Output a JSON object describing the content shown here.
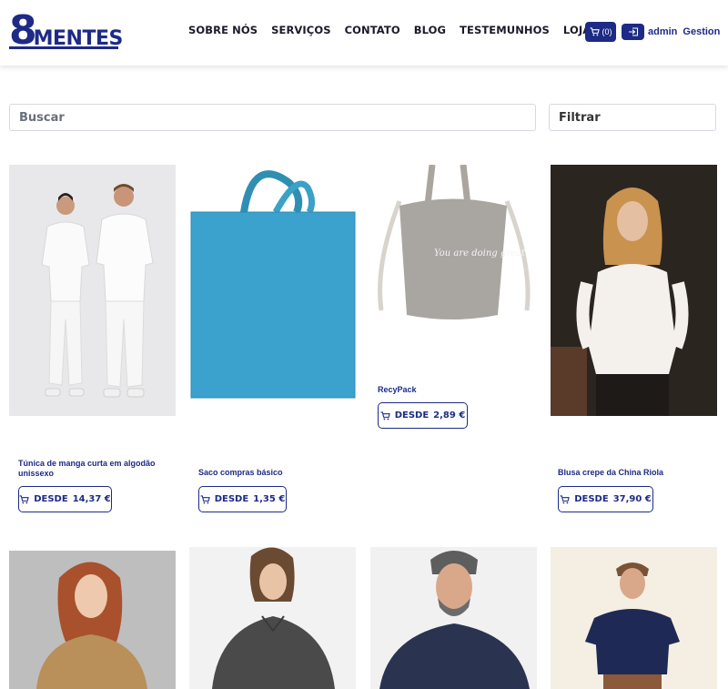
{
  "brand": {
    "logo_num": "8",
    "logo_word": "MENTES",
    "color": "#1d2a86"
  },
  "nav": {
    "items": [
      "SOBRE NÓS",
      "SERVIÇOS",
      "CONTATO",
      "BLOG",
      "TESTEMUNHOS",
      "LOJA"
    ]
  },
  "header_actions": {
    "cart_count": "(0)",
    "user": "admin",
    "gestion": "Gestion"
  },
  "search": {
    "placeholder": "Buscar",
    "filter_label": "Filtrar"
  },
  "products": [
    {
      "name": "Túnica de manga curta em algodão unissexo",
      "price_prefix": "DESDE",
      "price": "14,37 €",
      "image": "medical-uniform-photo"
    },
    {
      "name": "Saco compras básico",
      "price_prefix": "DESDE",
      "price": "1,35 €",
      "image": "blue-tote-bag-photo"
    },
    {
      "name": "RecyPack",
      "price_prefix": "DESDE",
      "price": "2,89 €",
      "image": "grey-drawstring-bag-photo",
      "bag_text": "You are doing great"
    },
    {
      "name": "Blusa crepe da China Riola",
      "price_prefix": "DESDE",
      "price": "37,90 €",
      "image": "white-blouse-photo"
    },
    {
      "name": "",
      "image": "gold-blouse-photo"
    },
    {
      "name": "",
      "image": "grey-shirt-woman-photo"
    },
    {
      "name": "",
      "image": "navy-shirt-man-photo"
    },
    {
      "name": "",
      "image": "navy-polo-man-photo"
    }
  ]
}
